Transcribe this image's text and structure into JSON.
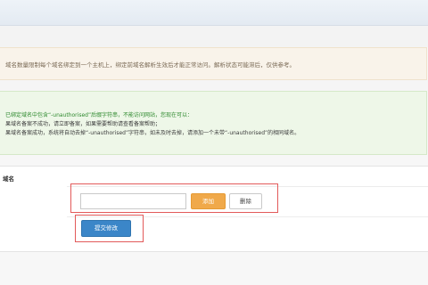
{
  "notice": {
    "text": "域名数量限制每个域名绑定到一个主机上，绑定前域名解析生效后才能正常访问。解析状态可能滞后，仅供参考。"
  },
  "tip": {
    "line1": "已绑定域名中包含“-unauthorised”后缀字符串，不能访问网站，您现在可以：",
    "line2": "果域名备案不成功，请立即备案，如果需要帮助请查看备案帮助；",
    "line3": "果域名备案成功，系统将自动去掉“-unauthorised”字符串，如未及时去掉，请添加一个未带“-unauthorised”的相同域名。"
  },
  "form": {
    "label": "域名",
    "domain_input": {
      "value": "",
      "placeholder": ""
    },
    "add_label": "添加",
    "delete_label": "删除",
    "submit_label": "提交修改"
  },
  "colors": {
    "add_button": "#f0a94a",
    "submit_button": "#3b86c8",
    "highlight_box": "#e25a5a",
    "tip_text": "#2f8a2f"
  }
}
